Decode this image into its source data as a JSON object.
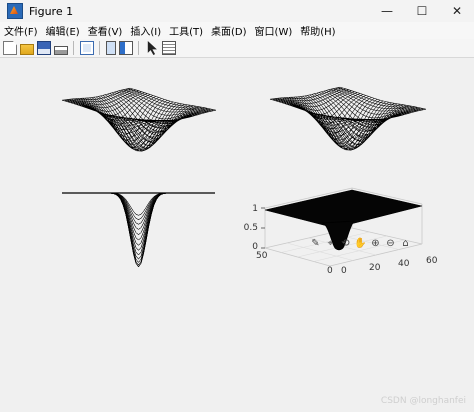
{
  "window": {
    "title": "Figure 1",
    "controls": {
      "minimize": "—",
      "maximize": "☐",
      "close": "✕"
    }
  },
  "menubar": {
    "items": [
      "文件(F)",
      "编辑(E)",
      "查看(V)",
      "插入(I)",
      "工具(T)",
      "桌面(D)",
      "窗口(W)",
      "帮助(H)"
    ]
  },
  "toolbar": {
    "icons": [
      "new-figure-icon",
      "open-file-icon",
      "save-icon",
      "print-icon",
      "print-preview-icon",
      "link-plot-icon",
      "property-editor-icon",
      "edit-plot-arrow-icon",
      "insert-legend-icon"
    ]
  },
  "axes_toolbar": {
    "icons": [
      "brush-icon",
      "data-tips-icon",
      "rotate-3d-icon",
      "pan-icon",
      "zoom-in-icon",
      "zoom-out-icon",
      "home-icon"
    ],
    "glyphs": [
      "✎",
      "⌖",
      "⟲",
      "✋",
      "⊕",
      "⊖",
      "⌂"
    ]
  },
  "subplot4": {
    "z_ticks": [
      "0",
      "0.5",
      "1"
    ],
    "y_ticks": [
      "50",
      "0"
    ],
    "x_ticks": [
      "0",
      "20",
      "40",
      "60"
    ]
  },
  "watermark": "CSDN @longhanfei",
  "colors": {
    "titlebar": "#f3f3f3",
    "background": "#f0f0f0",
    "mesh": "#000000"
  }
}
